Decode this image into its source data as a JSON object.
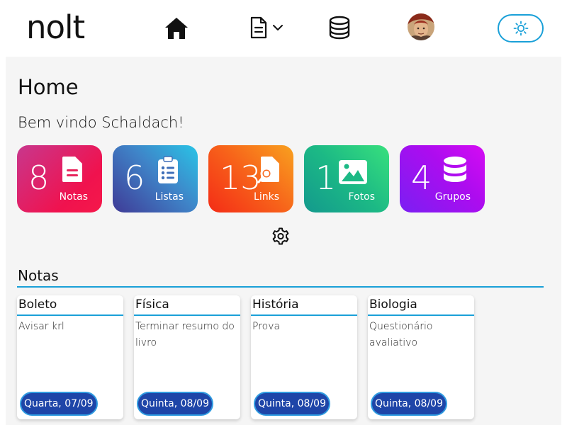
{
  "app": {
    "logo": "nolt"
  },
  "nav": {
    "icons": [
      "home-icon",
      "document-icon",
      "chevron-down-icon",
      "database-icon",
      "avatar",
      "sun-icon"
    ]
  },
  "colors": {
    "accent": "#1aa0d8",
    "date_badge": "#1e45a8",
    "panel_bg": "#f5f5f5"
  },
  "page": {
    "title": "Home",
    "welcome": "Bem vindo Schaldach!"
  },
  "stats": [
    {
      "count": "8",
      "label": "Notas",
      "icon": "note-icon"
    },
    {
      "count": "6",
      "label": "Listas",
      "icon": "clipboard-list-icon"
    },
    {
      "count": "13",
      "label": "Links",
      "icon": "file-search-icon"
    },
    {
      "count": "1",
      "label": "Fotos",
      "icon": "image-icon"
    },
    {
      "count": "4",
      "label": "Grupos",
      "icon": "database-icon"
    }
  ],
  "section": {
    "title": "Notas"
  },
  "notes": [
    {
      "title": "Boleto",
      "body": "Avisar krl",
      "date": "Quarta, 07/09"
    },
    {
      "title": "Física",
      "body": "Terminar resumo do livro",
      "date": "Quinta, 08/09"
    },
    {
      "title": "História",
      "body": "Prova",
      "date": "Quinta, 08/09"
    },
    {
      "title": "Biologia",
      "body": "Questionário avaliativo",
      "date": "Quinta, 08/09"
    }
  ]
}
